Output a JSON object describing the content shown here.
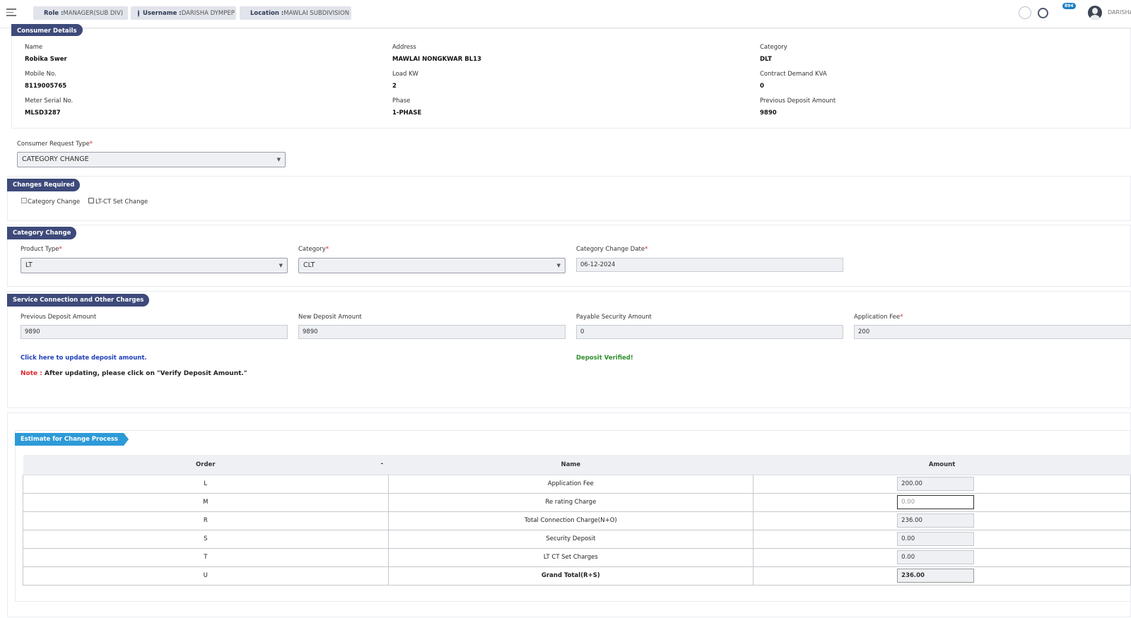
{
  "topbar": {
    "role_label": "Role :",
    "role_value": "MANAGER(SUB DIV)",
    "username_label": "Username :",
    "username_value": "DARISHA DYMPEP",
    "location_label": "Location :",
    "location_value": "MAWLAI SUBDIVISION",
    "notification_count": "894",
    "user_display": "DARISHA"
  },
  "consumer": {
    "section_title": "Consumer Details",
    "name_label": "Name",
    "name_value": "Robika Swer",
    "address_label": "Address",
    "address_value": "MAWLAI NONGKWAR BL13",
    "category_label": "Category",
    "category_value": "DLT",
    "mobile_label": "Mobile No.",
    "mobile_value": "8119005765",
    "load_label": "Load KW",
    "load_value": "2",
    "contract_label": "Contract Demand KVA",
    "contract_value": "0",
    "meter_label": "Meter Serial No.",
    "meter_value": "MLSD3287",
    "phase_label": "Phase",
    "phase_value": "1-PHASE",
    "prev_deposit_label": "Previous Deposit Amount",
    "prev_deposit_value": "9890"
  },
  "request": {
    "label": "Consumer Request Type",
    "value": "CATEGORY CHANGE"
  },
  "changes": {
    "section_title": "Changes Required",
    "opt1": "Category Change",
    "opt2": "LT-CT Set Change"
  },
  "category_change": {
    "section_title": "Category Change",
    "product_type_label": "Product Type",
    "product_type_value": "LT",
    "category_label": "Category",
    "category_value": "CLT",
    "date_label": "Category Change Date",
    "date_value": "06-12-2024"
  },
  "charges": {
    "section_title": "Service Connection and Other Charges",
    "prev_label": "Previous Deposit Amount",
    "prev_value": "9890",
    "new_label": "New Deposit Amount",
    "new_value": "9890",
    "payable_label": "Payable Security Amount",
    "payable_value": "0",
    "fee_label": "Application Fee",
    "fee_value": "200",
    "update_link": "Click here to update deposit amount.",
    "verified": "Deposit Verified!",
    "note_key": "Note :",
    "note_text": " After updating, please click on \"Verify Deposit Amount.\""
  },
  "estimate": {
    "section_title": "Estimate for Change Process",
    "col_order": "Order",
    "col_sort": "-",
    "col_name": "Name",
    "col_amount": "Amount",
    "rows": [
      {
        "order": "L",
        "name": "Application Fee",
        "amount": "200.00"
      },
      {
        "order": "M",
        "name": "Re rating Charge",
        "amount": "0.00"
      },
      {
        "order": "R",
        "name": "Total Connection Charge(N+O)",
        "amount": "236.00"
      },
      {
        "order": "S",
        "name": "Security Deposit",
        "amount": "0.00"
      },
      {
        "order": "T",
        "name": "LT CT Set Charges",
        "amount": "0.00"
      },
      {
        "order": "U",
        "name": "Grand Total(R+S)",
        "amount": "236.00"
      }
    ]
  }
}
